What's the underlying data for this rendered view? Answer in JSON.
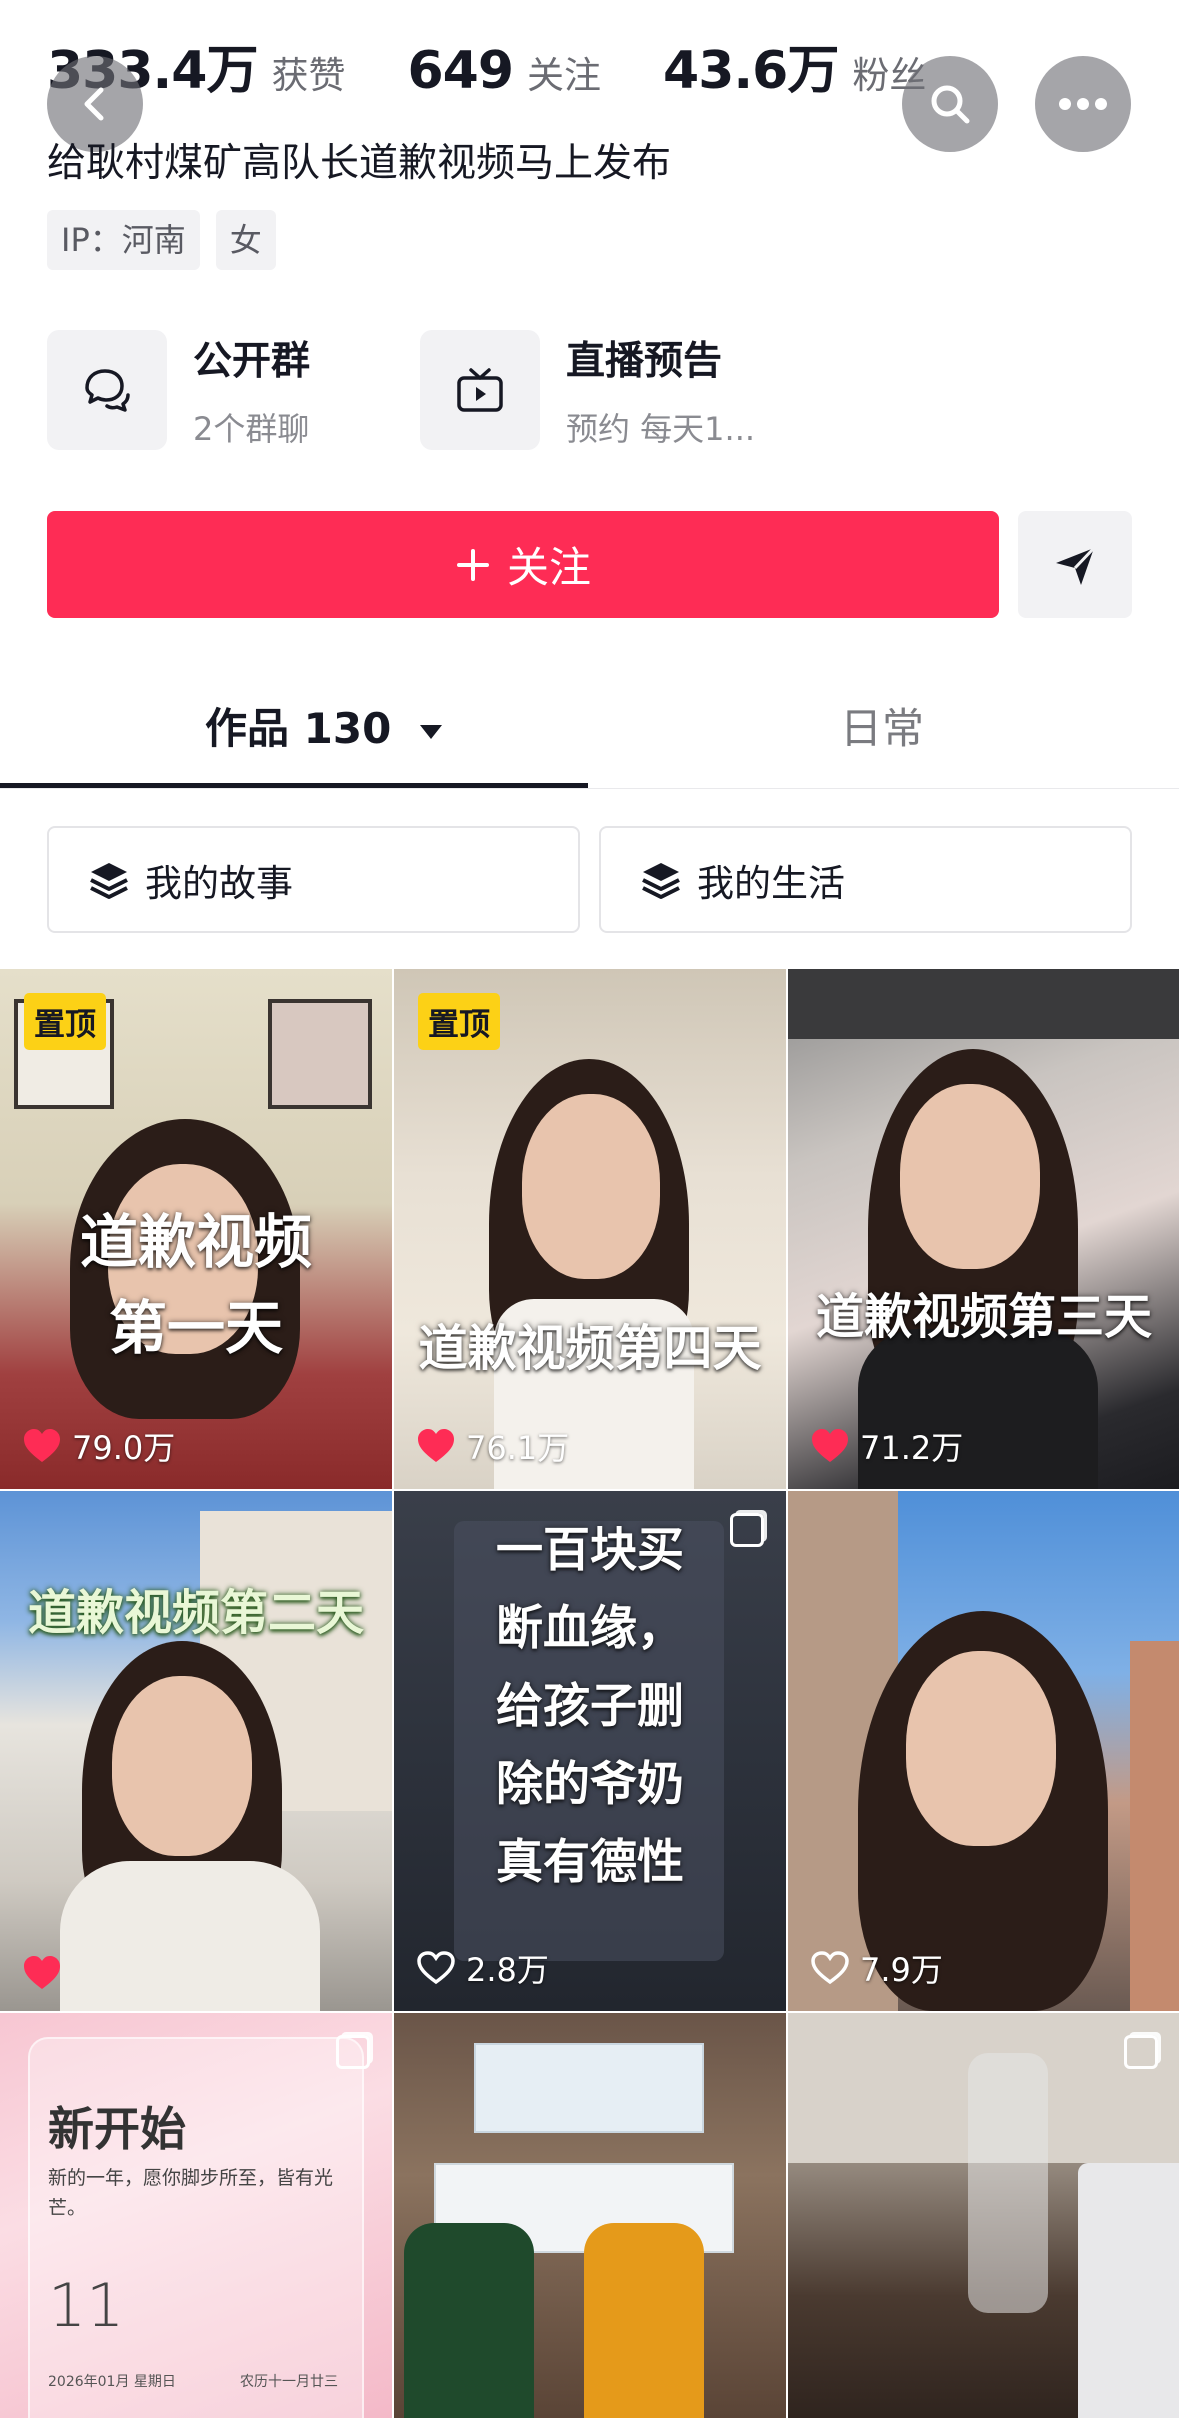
{
  "profile": {
    "stats": [
      {
        "value": "333.4万",
        "label": "获赞"
      },
      {
        "value": "649",
        "label": "关注"
      },
      {
        "value": "43.6万",
        "label": "粉丝"
      }
    ],
    "bio": "给耿村煤矿高队长道歉视频马上发布",
    "tags": [
      "IP：河南",
      "女"
    ]
  },
  "features": {
    "group": {
      "title": "公开群",
      "subtitle": "2个群聊"
    },
    "live": {
      "title": "直播预告",
      "subtitle": "预约 每天1..."
    }
  },
  "actions": {
    "follow_label": "关注"
  },
  "tabs": {
    "works_label": "作品 130",
    "daily_label": "日常"
  },
  "collections": [
    "我的故事",
    "我的生活"
  ],
  "videos": [
    {
      "pinned": "置顶",
      "overlay": "道歉视频",
      "overlay2": "第一天",
      "likes": "79.0万"
    },
    {
      "pinned": "置顶",
      "overlay": "道歉视频第四天",
      "likes": "76.1万"
    },
    {
      "overlay": "道歉视频第三天",
      "likes": "71.2万"
    },
    {
      "overlay": "道歉视频第二天",
      "likes": ""
    },
    {
      "overlay_lines": [
        "一百块买",
        "断血缘，",
        "给孩子删",
        "除的爷奶",
        "真有德性"
      ],
      "likes": "2.8万"
    },
    {
      "likes": "7.9万"
    },
    {
      "card_title": "新开始",
      "card_text": "新的一年，愿你脚步所至，皆有光芒。",
      "card_number": "11",
      "card_date": "2026年01月 星期日",
      "card_lunar": "农历十一月廿三"
    },
    {},
    {}
  ],
  "colors": {
    "accent": "#fe2c55",
    "pin": "#fcd116",
    "text": "#161823",
    "muted": "#8a8b91"
  },
  "icons": [
    "back-icon",
    "search-icon",
    "more-icon",
    "group-chat-icon",
    "tv-icon",
    "plus-icon",
    "send-icon",
    "caret-down-icon",
    "layers-icon",
    "heart-icon",
    "heart-outline-icon",
    "multi-image-icon"
  ]
}
